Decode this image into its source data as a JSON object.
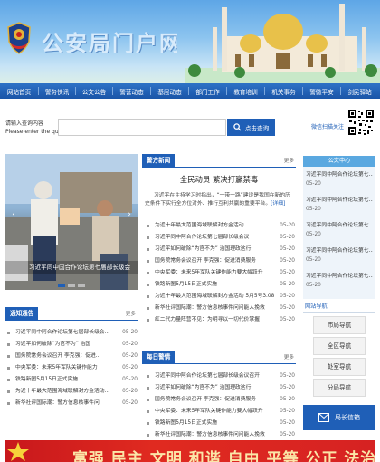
{
  "header": {
    "banner_logo_text": "公安局门户网站"
  },
  "nav": {
    "items": [
      "网站首页",
      "警务快讯",
      "公文公告",
      "警营动态",
      "基层动态",
      "部门工作",
      "教育培训",
      "机关事务",
      "警徽平安",
      "剑民驿站"
    ]
  },
  "search": {
    "label_line1": "请输入查询内容",
    "label_line2": "Please enter the query",
    "button_label": "点击查询",
    "weibo_label": "微信扫描关注"
  },
  "slider": {
    "caption": "习近平同中国合作论坛第七届部长级会"
  },
  "police_news": {
    "title": "警方新闻",
    "more": "更多",
    "headline": "全民动员 繁决打赢禁毒",
    "summary": "习近平在主持学习时指出，“一带一路”建设是我国在新的历史条件下实行全方位对外、推行互利共赢的重要平台。",
    "detail_link": "[详细]",
    "items": [
      {
        "title": "为近十年最大范围海域联解封方金活动",
        "date": "05-20"
      },
      {
        "title": "习近平同中阿合作论坛第七届部长级会议",
        "date": "05-20"
      },
      {
        "title": "习近平如何破除“为官不为” 治国理政这行",
        "date": "05-20"
      },
      {
        "title": "国务院常务会议召开 李克强：促进消费服务",
        "date": "05-20"
      },
      {
        "title": "中央军委：未来5年军队关键作能力要大幅跃升",
        "date": "05-20"
      },
      {
        "title": "铁路新图5月15日正式实施",
        "date": "05-20"
      },
      {
        "title": "为近十年最大范围海域联解封方金活动 5月5号3.08",
        "date": "05-20"
      },
      {
        "title": "新华社评国际潮：警方信息核事件问问能人挽救",
        "date": "05-20"
      },
      {
        "title": "红二代力量阵营不见：为明寻以一切代价掌握",
        "date": "05-20"
      }
    ]
  },
  "notices": {
    "title": "通知通告",
    "more": "更多",
    "items": [
      {
        "title": "习近平同中阿合作论坛第七届部长级会...",
        "date": "05-20"
      },
      {
        "title": "习近平如何破除“为官不为” 治国",
        "date": "05-20"
      },
      {
        "title": "国务院常务会议召开 李克强：促进...",
        "date": "05-20"
      },
      {
        "title": "中央军委：未来5年军队关键作能力",
        "date": "05-20"
      },
      {
        "title": "铁路新图5月15日正式实施",
        "date": "05-20"
      },
      {
        "title": "为近十年最大范围海域联解封方金活动...",
        "date": "05-20"
      },
      {
        "title": "新华社评国际潮：警方信息核事件问",
        "date": "05-20"
      }
    ]
  },
  "daily_alerts": {
    "title": "每日警情",
    "more": "更多",
    "items": [
      {
        "title": "习近平同中阿合作论坛第七届部长级会议召开",
        "date": "05-20"
      },
      {
        "title": "习近平如何破除“为官不为” 治国理政这行",
        "date": "05-20"
      },
      {
        "title": "国务院常务会议召开 李克强：促进消费服务",
        "date": "05-20"
      },
      {
        "title": "中央军委：未来5年军队关键作能力要大幅跃升",
        "date": "05-20"
      },
      {
        "title": "铁路新图5月15日正式实施",
        "date": "05-20"
      },
      {
        "title": "新华社评国际潮：警方信息核事件问问能人挽救",
        "date": "05-20"
      }
    ]
  },
  "public_center": {
    "title": "公文中心",
    "items": [
      {
        "title": "习近平同中阿合作论坛第七...",
        "date": "05-20"
      },
      {
        "title": "习近平同中阿合作论坛第七...",
        "date": "05-20"
      },
      {
        "title": "习近平同中阿合作论坛第七...",
        "date": "05-20"
      },
      {
        "title": "习近平同中阿合作论坛第七...",
        "date": "05-20"
      },
      {
        "title": "习近平同中阿合作论坛第七...",
        "date": "05-20"
      }
    ]
  },
  "site_nav": {
    "title": "网站导航",
    "buttons": [
      "市局导航",
      "全区导航",
      "处室导航",
      "分局导航"
    ]
  },
  "mailbox": {
    "label": "局长信箱"
  },
  "bottom_banner": {
    "text": "富强 民主 文明 和谐 自由 平等 公正 法治"
  }
}
